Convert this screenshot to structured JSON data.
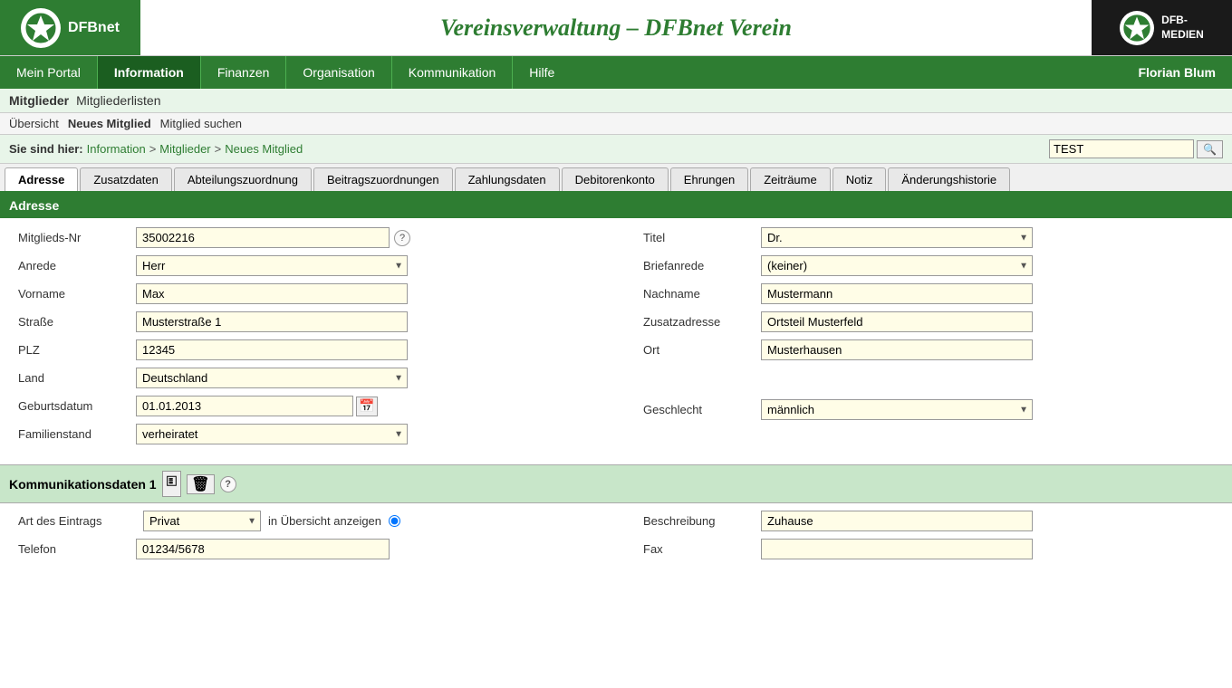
{
  "header": {
    "logo_text": "DFBnet",
    "title": "Vereinsverwaltung – DFBnet Verein",
    "right_logo_text": "DFB-\nMEDIEN"
  },
  "nav": {
    "items": [
      {
        "label": "Mein Portal",
        "active": false
      },
      {
        "label": "Information",
        "active": true
      },
      {
        "label": "Finanzen",
        "active": false
      },
      {
        "label": "Organisation",
        "active": false
      },
      {
        "label": "Kommunikation",
        "active": false
      },
      {
        "label": "Hilfe",
        "active": false
      }
    ],
    "user": "Florian Blum"
  },
  "subnav": {
    "items": [
      {
        "label": "Mitglieder",
        "bold": true
      },
      {
        "label": "Mitgliederlisten",
        "bold": false
      }
    ],
    "sub_items": [
      {
        "label": "Übersicht",
        "bold": false
      },
      {
        "label": "Neues Mitglied",
        "bold": true
      },
      {
        "label": "Mitglied suchen",
        "bold": false
      }
    ]
  },
  "breadcrumb": {
    "prefix": "Sie sind hier:",
    "links": [
      "Information",
      "Mitglieder",
      "Neues Mitglied"
    ],
    "separator": ">"
  },
  "search": {
    "value": "TEST",
    "placeholder": ""
  },
  "tabs": {
    "items": [
      {
        "label": "Adresse",
        "active": true
      },
      {
        "label": "Zusatzdaten",
        "active": false
      },
      {
        "label": "Abteilungszuordnung",
        "active": false
      },
      {
        "label": "Beitragszuordnungen",
        "active": false
      },
      {
        "label": "Zahlungsdaten",
        "active": false
      },
      {
        "label": "Debitorenkonto",
        "active": false
      },
      {
        "label": "Ehrungen",
        "active": false
      },
      {
        "label": "Zeiträume",
        "active": false
      },
      {
        "label": "Notiz",
        "active": false
      },
      {
        "label": "Änderungshistorie",
        "active": false
      }
    ]
  },
  "section": {
    "title": "Adresse"
  },
  "form": {
    "left": {
      "fields": [
        {
          "label": "Mitglieds-Nr",
          "value": "35002216",
          "type": "input",
          "help": true
        },
        {
          "label": "Anrede",
          "value": "Herr",
          "type": "select"
        },
        {
          "label": "Vorname",
          "value": "Max",
          "type": "input"
        },
        {
          "label": "Straße",
          "value": "Musterstraße 1",
          "type": "input"
        },
        {
          "label": "PLZ",
          "value": "12345",
          "type": "input"
        },
        {
          "label": "Land",
          "value": "Deutschland",
          "type": "select"
        },
        {
          "label": "Geburtsdatum",
          "value": "01.01.2013",
          "type": "input",
          "calendar": true
        },
        {
          "label": "Familienstand",
          "value": "verheiratet",
          "type": "select"
        }
      ]
    },
    "right": {
      "fields": [
        {
          "label": "Titel",
          "value": "Dr.",
          "type": "select"
        },
        {
          "label": "Briefanrede",
          "value": "(keiner)",
          "type": "select"
        },
        {
          "label": "Nachname",
          "value": "Mustermann",
          "type": "input"
        },
        {
          "label": "Zusatzadresse",
          "value": "Ortsteil Musterfeld",
          "type": "input"
        },
        {
          "label": "Ort",
          "value": "Musterhausen",
          "type": "input"
        },
        {
          "label": "Geschlecht",
          "value": "männlich",
          "type": "select"
        }
      ]
    }
  },
  "kommunikation": {
    "title": "Kommunikationsdaten 1",
    "left": {
      "art_label": "Art des Eintrags",
      "art_value": "Privat",
      "anzeigen_label": "in Übersicht anzeigen",
      "telefon_label": "Telefon",
      "telefon_value": "01234/5678"
    },
    "right": {
      "beschreibung_label": "Beschreibung",
      "beschreibung_value": "Zuhause",
      "fax_label": "Fax",
      "fax_value": ""
    }
  }
}
